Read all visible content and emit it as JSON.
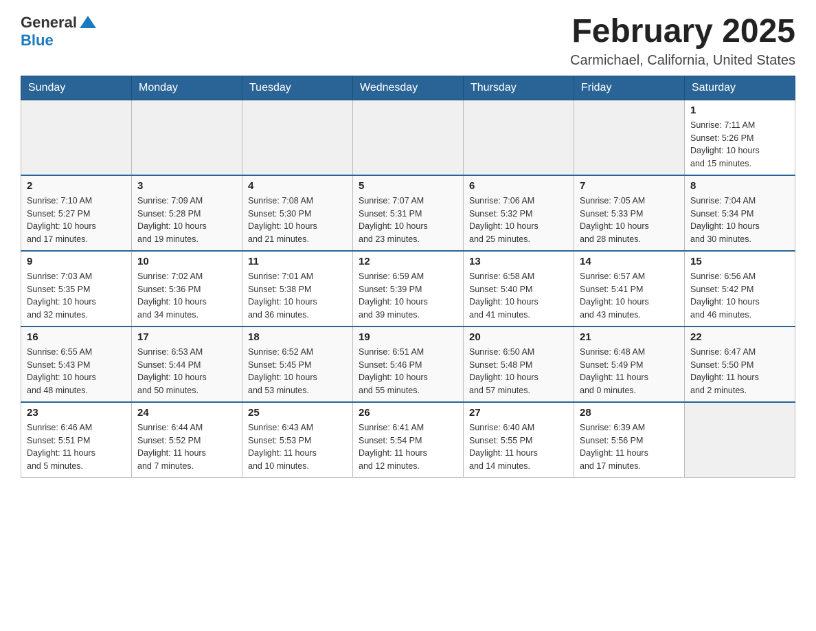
{
  "header": {
    "logo_general": "General",
    "logo_blue": "Blue",
    "month_title": "February 2025",
    "location": "Carmichael, California, United States"
  },
  "weekdays": [
    "Sunday",
    "Monday",
    "Tuesday",
    "Wednesday",
    "Thursday",
    "Friday",
    "Saturday"
  ],
  "weeks": [
    {
      "days": [
        {
          "number": "",
          "info": ""
        },
        {
          "number": "",
          "info": ""
        },
        {
          "number": "",
          "info": ""
        },
        {
          "number": "",
          "info": ""
        },
        {
          "number": "",
          "info": ""
        },
        {
          "number": "",
          "info": ""
        },
        {
          "number": "1",
          "info": "Sunrise: 7:11 AM\nSunset: 5:26 PM\nDaylight: 10 hours\nand 15 minutes."
        }
      ]
    },
    {
      "days": [
        {
          "number": "2",
          "info": "Sunrise: 7:10 AM\nSunset: 5:27 PM\nDaylight: 10 hours\nand 17 minutes."
        },
        {
          "number": "3",
          "info": "Sunrise: 7:09 AM\nSunset: 5:28 PM\nDaylight: 10 hours\nand 19 minutes."
        },
        {
          "number": "4",
          "info": "Sunrise: 7:08 AM\nSunset: 5:30 PM\nDaylight: 10 hours\nand 21 minutes."
        },
        {
          "number": "5",
          "info": "Sunrise: 7:07 AM\nSunset: 5:31 PM\nDaylight: 10 hours\nand 23 minutes."
        },
        {
          "number": "6",
          "info": "Sunrise: 7:06 AM\nSunset: 5:32 PM\nDaylight: 10 hours\nand 25 minutes."
        },
        {
          "number": "7",
          "info": "Sunrise: 7:05 AM\nSunset: 5:33 PM\nDaylight: 10 hours\nand 28 minutes."
        },
        {
          "number": "8",
          "info": "Sunrise: 7:04 AM\nSunset: 5:34 PM\nDaylight: 10 hours\nand 30 minutes."
        }
      ]
    },
    {
      "days": [
        {
          "number": "9",
          "info": "Sunrise: 7:03 AM\nSunset: 5:35 PM\nDaylight: 10 hours\nand 32 minutes."
        },
        {
          "number": "10",
          "info": "Sunrise: 7:02 AM\nSunset: 5:36 PM\nDaylight: 10 hours\nand 34 minutes."
        },
        {
          "number": "11",
          "info": "Sunrise: 7:01 AM\nSunset: 5:38 PM\nDaylight: 10 hours\nand 36 minutes."
        },
        {
          "number": "12",
          "info": "Sunrise: 6:59 AM\nSunset: 5:39 PM\nDaylight: 10 hours\nand 39 minutes."
        },
        {
          "number": "13",
          "info": "Sunrise: 6:58 AM\nSunset: 5:40 PM\nDaylight: 10 hours\nand 41 minutes."
        },
        {
          "number": "14",
          "info": "Sunrise: 6:57 AM\nSunset: 5:41 PM\nDaylight: 10 hours\nand 43 minutes."
        },
        {
          "number": "15",
          "info": "Sunrise: 6:56 AM\nSunset: 5:42 PM\nDaylight: 10 hours\nand 46 minutes."
        }
      ]
    },
    {
      "days": [
        {
          "number": "16",
          "info": "Sunrise: 6:55 AM\nSunset: 5:43 PM\nDaylight: 10 hours\nand 48 minutes."
        },
        {
          "number": "17",
          "info": "Sunrise: 6:53 AM\nSunset: 5:44 PM\nDaylight: 10 hours\nand 50 minutes."
        },
        {
          "number": "18",
          "info": "Sunrise: 6:52 AM\nSunset: 5:45 PM\nDaylight: 10 hours\nand 53 minutes."
        },
        {
          "number": "19",
          "info": "Sunrise: 6:51 AM\nSunset: 5:46 PM\nDaylight: 10 hours\nand 55 minutes."
        },
        {
          "number": "20",
          "info": "Sunrise: 6:50 AM\nSunset: 5:48 PM\nDaylight: 10 hours\nand 57 minutes."
        },
        {
          "number": "21",
          "info": "Sunrise: 6:48 AM\nSunset: 5:49 PM\nDaylight: 11 hours\nand 0 minutes."
        },
        {
          "number": "22",
          "info": "Sunrise: 6:47 AM\nSunset: 5:50 PM\nDaylight: 11 hours\nand 2 minutes."
        }
      ]
    },
    {
      "days": [
        {
          "number": "23",
          "info": "Sunrise: 6:46 AM\nSunset: 5:51 PM\nDaylight: 11 hours\nand 5 minutes."
        },
        {
          "number": "24",
          "info": "Sunrise: 6:44 AM\nSunset: 5:52 PM\nDaylight: 11 hours\nand 7 minutes."
        },
        {
          "number": "25",
          "info": "Sunrise: 6:43 AM\nSunset: 5:53 PM\nDaylight: 11 hours\nand 10 minutes."
        },
        {
          "number": "26",
          "info": "Sunrise: 6:41 AM\nSunset: 5:54 PM\nDaylight: 11 hours\nand 12 minutes."
        },
        {
          "number": "27",
          "info": "Sunrise: 6:40 AM\nSunset: 5:55 PM\nDaylight: 11 hours\nand 14 minutes."
        },
        {
          "number": "28",
          "info": "Sunrise: 6:39 AM\nSunset: 5:56 PM\nDaylight: 11 hours\nand 17 minutes."
        },
        {
          "number": "",
          "info": ""
        }
      ]
    }
  ]
}
